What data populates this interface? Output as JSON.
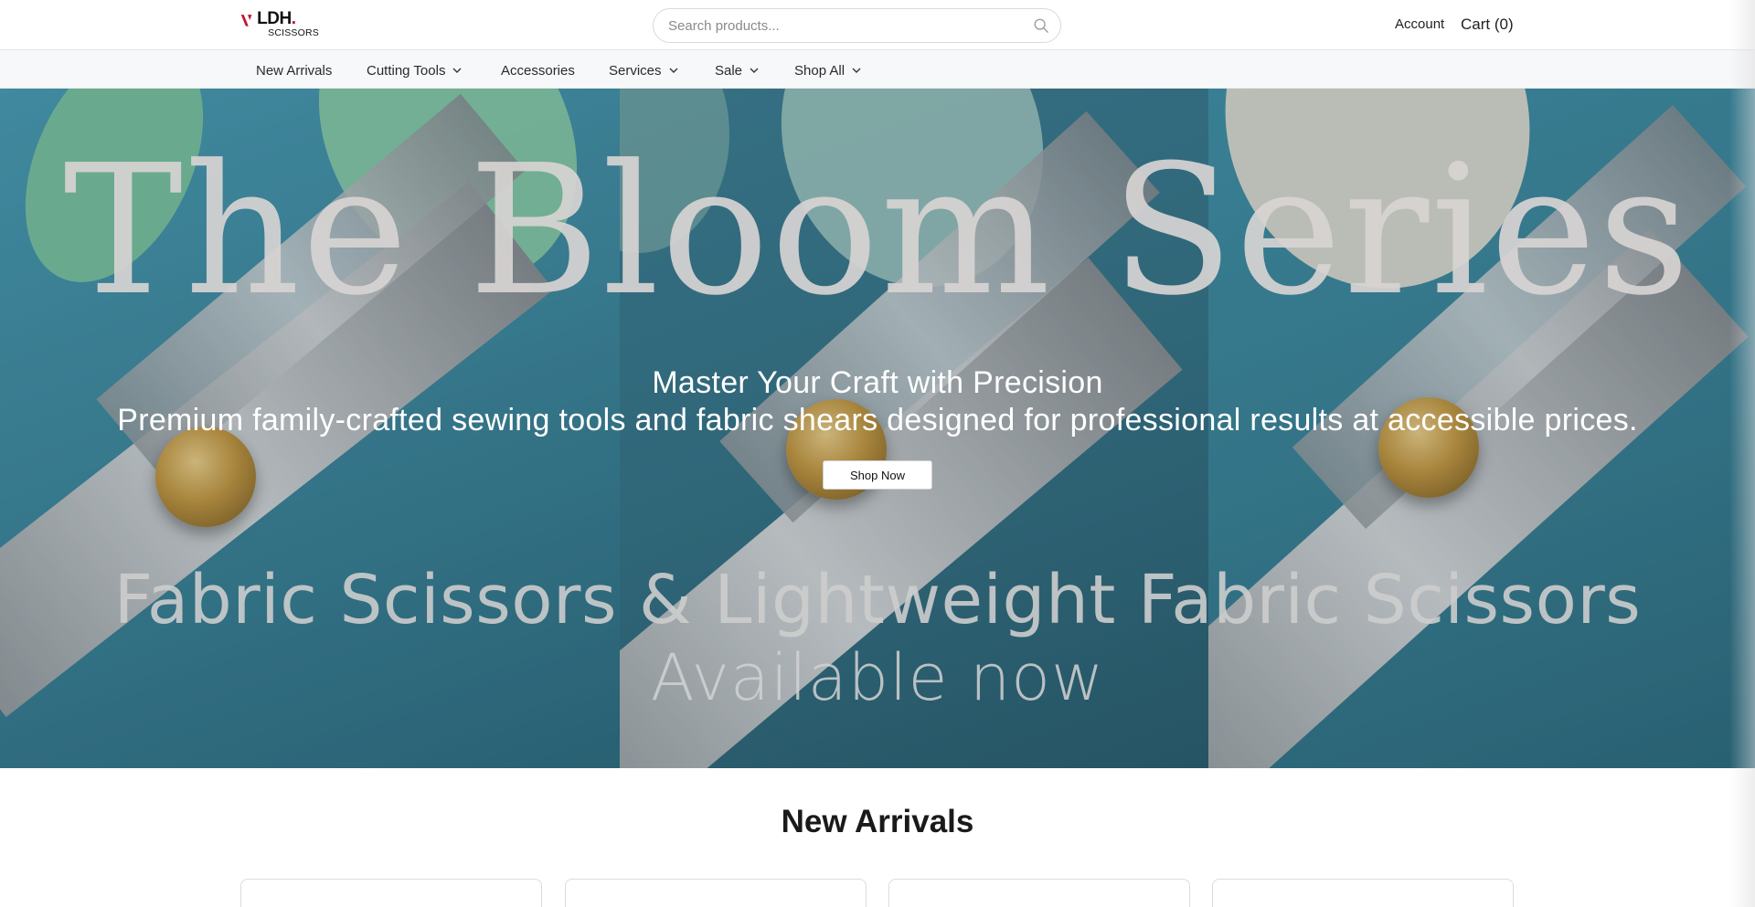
{
  "header": {
    "logo_word": "LDH",
    "logo_dot": ".",
    "logo_sub": "SCISSORS",
    "search_placeholder": "Search products...",
    "account_label": "Account",
    "cart_label": "Cart (0)"
  },
  "nav": {
    "items": [
      {
        "label": "New Arrivals",
        "has_dropdown": false
      },
      {
        "label": "Cutting Tools",
        "has_dropdown": true
      },
      {
        "label": "Accessories",
        "has_dropdown": false
      },
      {
        "label": "Services",
        "has_dropdown": true
      },
      {
        "label": "Sale",
        "has_dropdown": true
      },
      {
        "label": "Shop All",
        "has_dropdown": true
      }
    ]
  },
  "hero": {
    "bloom_text": "The Bloom Series",
    "title": "Master Your Craft with Precision",
    "subtitle": "Premium family-crafted sewing tools and fabric shears designed for professional results at accessible prices.",
    "button_label": "Shop Now",
    "fabric_text": "Fabric Scissors & Lightweight Fabric Scissors",
    "available_text": "Available now"
  },
  "new_arrivals": {
    "title": "New Arrivals",
    "card_count": 4
  },
  "colors": {
    "brand_red": "#c8102e",
    "hero_teal": "#3d8aa0",
    "handle_green": "#7fc9a2",
    "handle_sage": "#9cc7bd",
    "handle_cream": "#e6e4d6"
  },
  "icons": {
    "search": "search-icon",
    "chevron": "chevron-down-icon"
  }
}
